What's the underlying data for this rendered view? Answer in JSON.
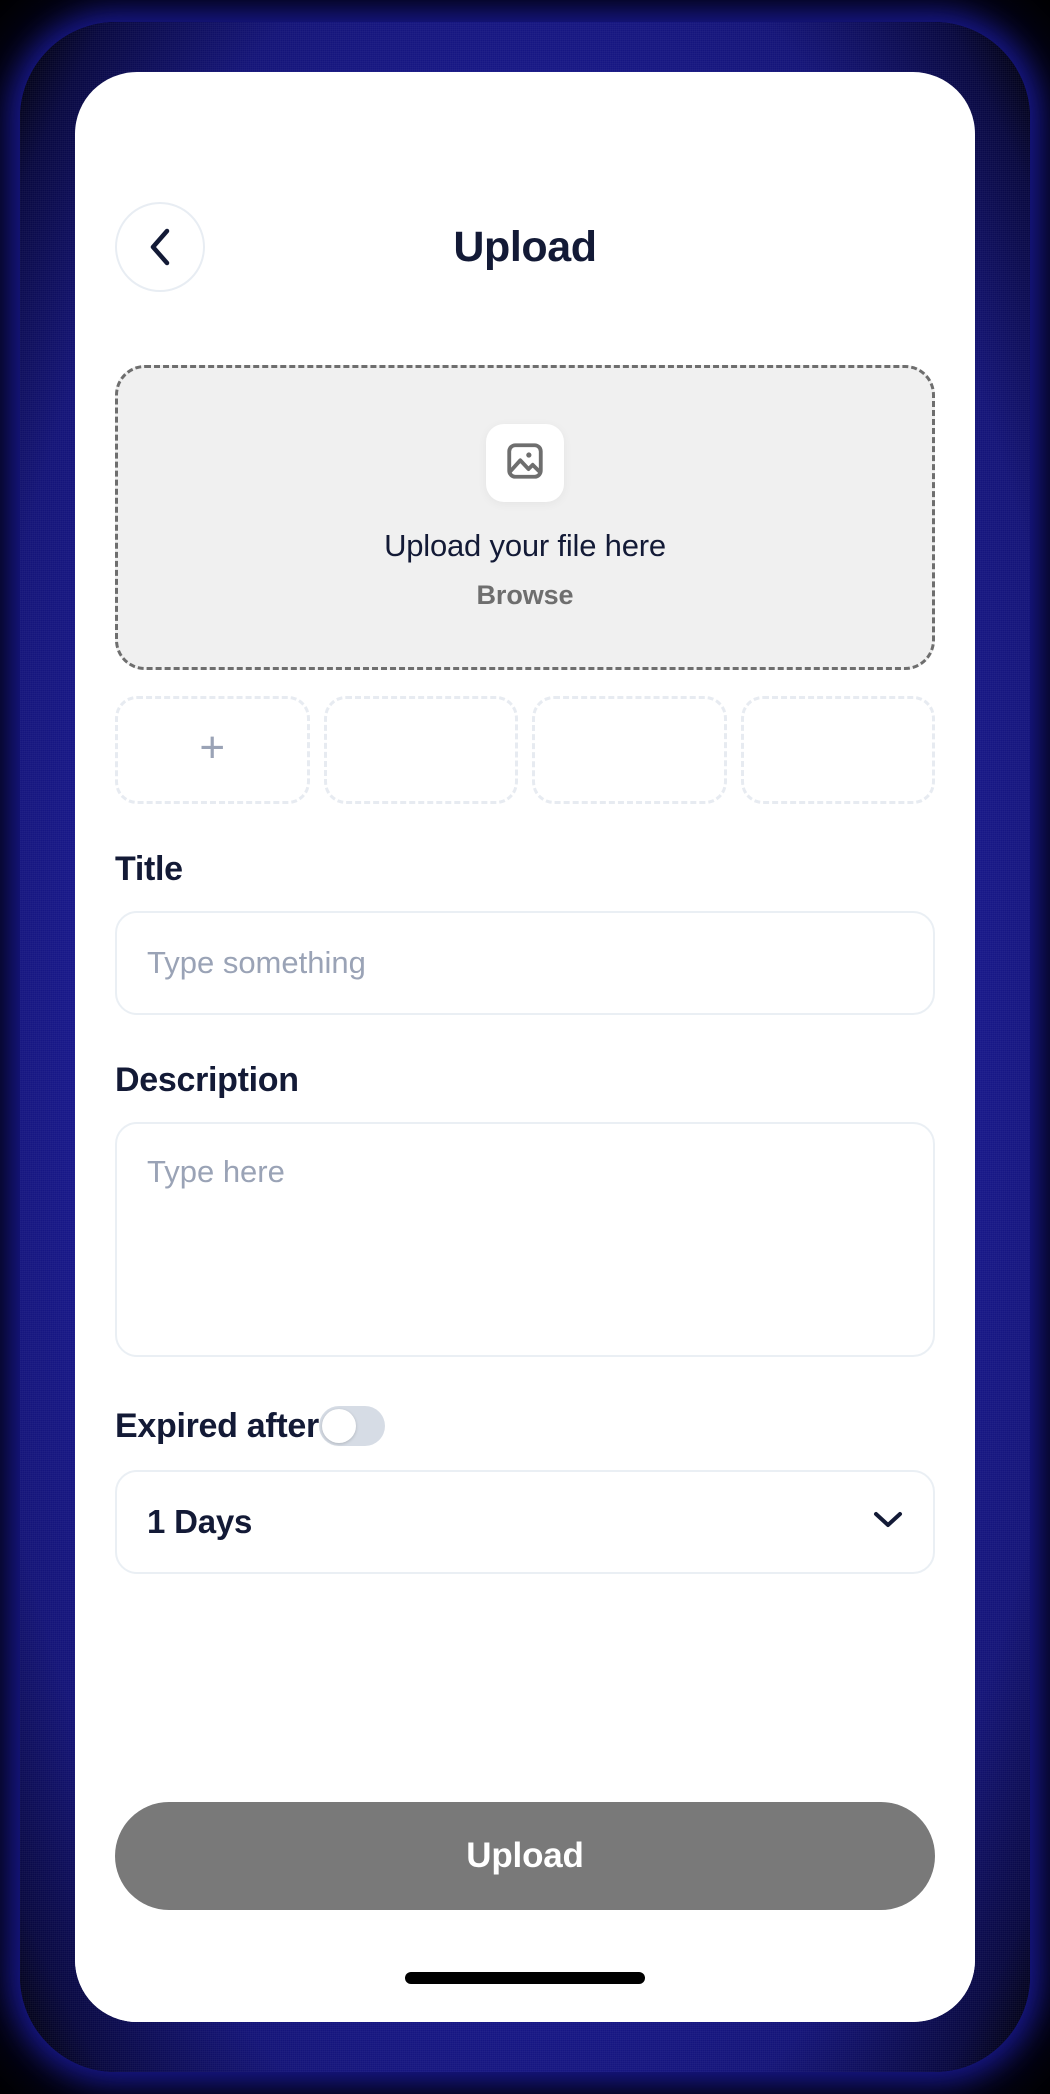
{
  "header": {
    "title": "Upload",
    "back_icon": "chevron-left-icon"
  },
  "dropzone": {
    "icon": "image-icon",
    "title": "Upload your file here",
    "browse_label": "Browse"
  },
  "thumbnails": {
    "add_icon": "plus-icon",
    "slots": [
      {
        "id": "slot-1",
        "has_add": true
      },
      {
        "id": "slot-2",
        "has_add": false
      },
      {
        "id": "slot-3",
        "has_add": false
      },
      {
        "id": "slot-4",
        "has_add": false
      }
    ]
  },
  "form": {
    "title": {
      "label": "Title",
      "placeholder": "Type something",
      "value": ""
    },
    "description": {
      "label": "Description",
      "placeholder": "Type here",
      "value": ""
    },
    "expired": {
      "label": "Expired after",
      "toggle_state": "off",
      "duration_value": "1 Days",
      "chevron_icon": "chevron-down-icon"
    }
  },
  "footer": {
    "upload_label": "Upload",
    "upload_state": "disabled"
  },
  "colors": {
    "device_frame": "#1a1a94",
    "text_primary": "#131a36",
    "text_muted": "#9aa3b6",
    "dropzone_fill": "#f0f0f0",
    "dropzone_border": "#6e6e6e",
    "field_border": "#eaeff4",
    "cta_background": "#797979",
    "toggle_track": "#d6dce5"
  }
}
